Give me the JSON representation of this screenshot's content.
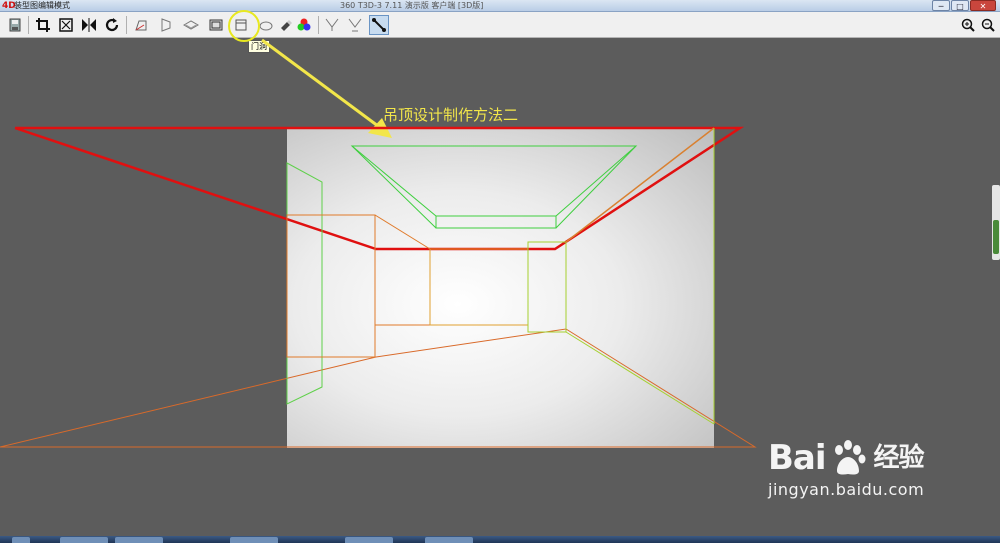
{
  "window": {
    "title": "装型图编辑模式",
    "info": "360 T3D-3 7.11 演示版 客户端 [3D版]",
    "min_label": "─",
    "max_label": "□",
    "close_label": "✕"
  },
  "toolbar": {
    "tools": [
      {
        "name": "save-tool",
        "icon": "save-icon"
      },
      {
        "name": "crop-tool",
        "icon": "crop-icon"
      },
      {
        "name": "fit-tool",
        "icon": "fit-icon"
      },
      {
        "name": "mirror-tool",
        "icon": "mirror-icon"
      },
      {
        "name": "rotate-tool",
        "icon": "rotate-icon"
      },
      {
        "name": "wall-tool",
        "icon": "wall-icon"
      },
      {
        "name": "side-wall-tool",
        "icon": "side-wall-icon"
      },
      {
        "name": "floor-tool",
        "icon": "floor-icon"
      },
      {
        "name": "window-tool",
        "icon": "window-icon"
      },
      {
        "name": "door-opening-tool",
        "icon": "door-opening-icon"
      },
      {
        "name": "ellipse-tool",
        "icon": "ellipse-icon"
      },
      {
        "name": "eraser-tool",
        "icon": "eraser-icon"
      },
      {
        "name": "color-tool",
        "icon": "color-icon"
      },
      {
        "name": "node-add-tool",
        "icon": "node-add-icon"
      },
      {
        "name": "node-remove-tool",
        "icon": "node-remove-icon"
      },
      {
        "name": "line-tool",
        "icon": "line-icon"
      }
    ],
    "zoom_in_icon": "zoom-in-icon",
    "zoom_out_icon": "zoom-out-icon",
    "tooltip": "门洞"
  },
  "annotation": {
    "text": "吊顶设计制作方法二",
    "arrow_color": "#f2e64a"
  },
  "colors": {
    "workspace": "#5c5c5c",
    "perspective_line": "#e01010",
    "wireframe_green": "#3fcf3f",
    "wireframe_orange": "#e07a2a",
    "active_tool": "#c8dcf0"
  },
  "watermark": {
    "brand_left": "Bai",
    "brand_right": "经验",
    "url": "jingyan.baidu.com"
  }
}
